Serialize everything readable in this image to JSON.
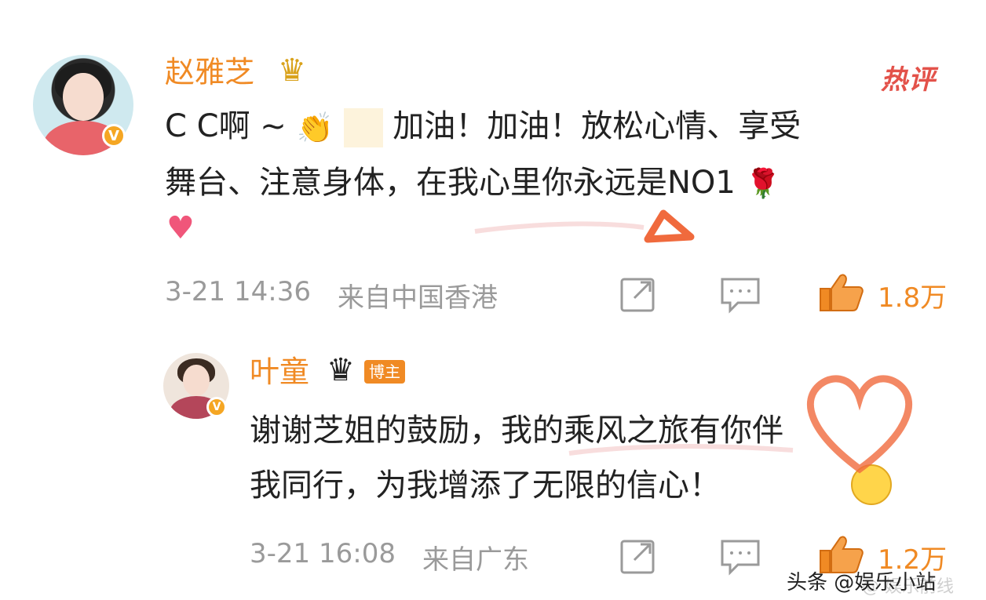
{
  "comment": {
    "username": "赵雅芝",
    "hot_label": "热评",
    "text_line1": "C C啊 ~",
    "text_line1_rest": "加油！加油！放松心情、享受",
    "text_line2": "舞台、注意身体，在我心里你永远是NO1",
    "time": "3-21 14:36",
    "source": "来自中国香港",
    "likes": "1.8万",
    "icons": [
      "verified-v-icon",
      "crown-icon",
      "clap-emoji",
      "flower-emoji",
      "heart-emoji",
      "share-icon",
      "comment-icon",
      "thumbs-up-icon"
    ]
  },
  "reply": {
    "username": "叶童",
    "badge": "博主",
    "text_line1": "谢谢芝姐的鼓励，我的乘风之旅有你伴",
    "text_line2": "我同行，为我增添了无限的信心！",
    "time": "3-21 16:08",
    "source": "来自广东",
    "likes": "1.2万"
  },
  "watermark": {
    "text": "头条 @娱乐小站",
    "faint": "@ 娱乐前线"
  },
  "colors": {
    "accent": "#f08a24",
    "hot": "#e3524a",
    "meta": "#9a9a9a",
    "text": "#222222"
  }
}
